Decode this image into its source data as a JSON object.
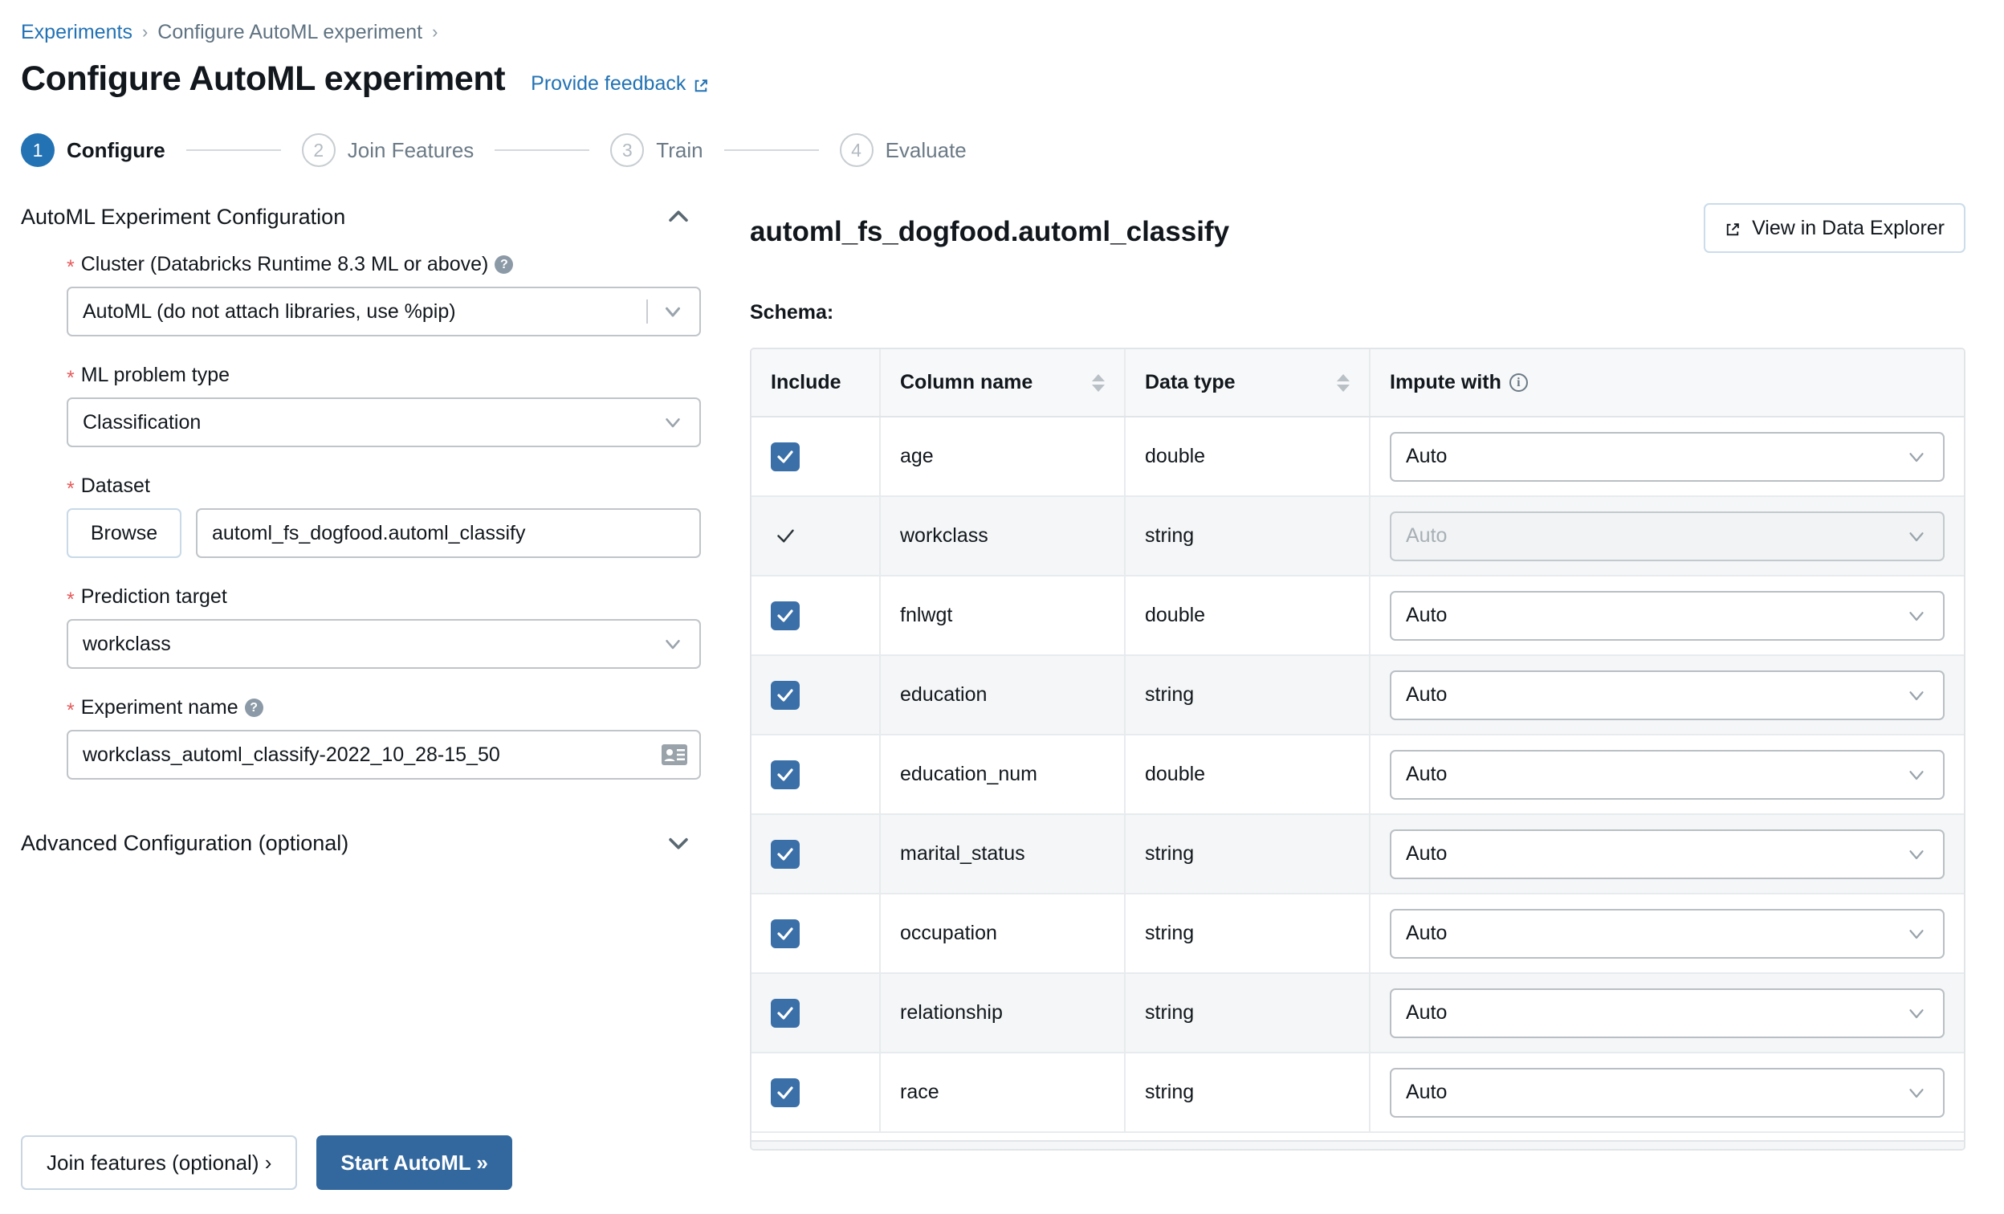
{
  "breadcrumb": {
    "root": "Experiments",
    "current": "Configure AutoML experiment",
    "separator": "›"
  },
  "header": {
    "title": "Configure AutoML experiment",
    "feedback_label": "Provide feedback"
  },
  "stepper": {
    "steps": [
      {
        "num": "1",
        "label": "Configure",
        "state": "active"
      },
      {
        "num": "2",
        "label": "Join Features",
        "state": "idle"
      },
      {
        "num": "3",
        "label": "Train",
        "state": "idle"
      },
      {
        "num": "4",
        "label": "Evaluate",
        "state": "idle"
      }
    ]
  },
  "config_section": {
    "title": "AutoML Experiment Configuration",
    "collapse_icon": "chevron-up-icon",
    "fields": {
      "cluster": {
        "label": "Cluster (Databricks Runtime 8.3 ML or above)",
        "required": "*",
        "help_icon": "question-circle-icon",
        "value": "AutoML (do not attach libraries, use %pip)"
      },
      "problem_type": {
        "label": "ML problem type",
        "required": "*",
        "value": "Classification"
      },
      "dataset": {
        "label": "Dataset",
        "required": "*",
        "browse_label": "Browse",
        "value": "automl_fs_dogfood.automl_classify"
      },
      "prediction_target": {
        "label": "Prediction target",
        "required": "*",
        "value": "workclass"
      },
      "experiment_name": {
        "label": "Experiment name",
        "required": "*",
        "help_icon": "question-circle-icon",
        "value": "workclass_automl_classify-2022_10_28-15_50",
        "trailing_icon": "contact-card-icon"
      }
    }
  },
  "advanced_section": {
    "title": "Advanced Configuration (optional)",
    "expand_icon": "chevron-down-icon"
  },
  "right_pane": {
    "table_name": "automl_fs_dogfood.automl_classify",
    "explorer_button": {
      "label": "View in Data Explorer",
      "icon": "external-link-icon"
    },
    "schema_label": "Schema:",
    "columns": [
      {
        "key": "include",
        "label": "Include",
        "sortable": false
      },
      {
        "key": "name",
        "label": "Column name",
        "sortable": true
      },
      {
        "key": "type",
        "label": "Data type",
        "sortable": true
      },
      {
        "key": "impute",
        "label": "Impute with",
        "sortable": false,
        "info_icon": "info-circle-icon"
      }
    ],
    "rows": [
      {
        "include": true,
        "disabled": false,
        "name": "age",
        "type": "double",
        "impute": "Auto"
      },
      {
        "include": true,
        "disabled": true,
        "name": "workclass",
        "type": "string",
        "impute": "Auto"
      },
      {
        "include": true,
        "disabled": false,
        "name": "fnlwgt",
        "type": "double",
        "impute": "Auto"
      },
      {
        "include": true,
        "disabled": false,
        "name": "education",
        "type": "string",
        "impute": "Auto"
      },
      {
        "include": true,
        "disabled": false,
        "name": "education_num",
        "type": "double",
        "impute": "Auto"
      },
      {
        "include": true,
        "disabled": false,
        "name": "marital_status",
        "type": "string",
        "impute": "Auto"
      },
      {
        "include": true,
        "disabled": false,
        "name": "occupation",
        "type": "string",
        "impute": "Auto"
      },
      {
        "include": true,
        "disabled": false,
        "name": "relationship",
        "type": "string",
        "impute": "Auto"
      },
      {
        "include": true,
        "disabled": false,
        "name": "race",
        "type": "string",
        "impute": "Auto"
      }
    ]
  },
  "footer": {
    "join_features_label": "Join features (optional) ›",
    "start_label": "Start AutoML »"
  },
  "colors": {
    "accent_blue": "#2272b4",
    "primary_button": "#33689e",
    "checkbox_blue": "#3b6fa8",
    "required_red": "#e65b5b",
    "row_alt": "#f4f6f7"
  }
}
